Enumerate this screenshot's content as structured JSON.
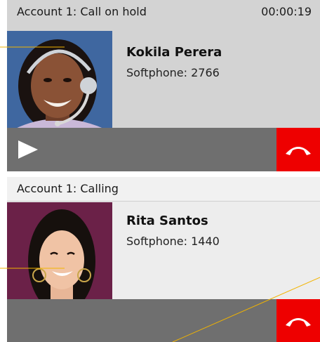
{
  "calls": [
    {
      "status": "Account 1: Call on hold",
      "timer": "00:00:19",
      "contact_name": "Kokila Perera",
      "extension": "Softphone: 2766",
      "avatar_bg": "#3f67a0"
    },
    {
      "status": "Account 1: Calling",
      "contact_name": "Rita Santos",
      "extension": "Softphone: 1440",
      "avatar_bg": "#6b2148"
    }
  ],
  "colors": {
    "panel_hold": "#d3d3d3",
    "header_calling": "#f1f1f1",
    "panel_calling": "#ededed",
    "control_bar": "#6f6f6f",
    "hangup": "#ee0000",
    "callout_line": "#f2b400"
  },
  "icons": [
    "play-icon",
    "hang-up-icon"
  ]
}
